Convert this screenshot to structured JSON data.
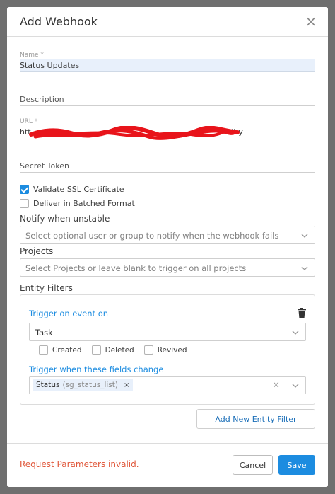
{
  "dialog": {
    "title": "Add Webhook",
    "close_icon": "close-icon"
  },
  "form": {
    "name": {
      "label": "Name *",
      "value": "Status Updates"
    },
    "description": {
      "label": "Description"
    },
    "url": {
      "label": "URL *",
      "value_start": "htt",
      "value_end": "tlby",
      "redacted": true
    },
    "secret_token": {
      "label": "Secret Token"
    },
    "validate_ssl": {
      "label": "Validate SSL Certificate",
      "checked": true
    },
    "batched": {
      "label": "Deliver in Batched Format",
      "checked": false
    },
    "notify": {
      "label": "Notify when unstable",
      "placeholder": "Select optional user or group to notify when the webhook fails"
    },
    "projects": {
      "label": "Projects",
      "placeholder": "Select Projects or leave blank to trigger on all projects"
    }
  },
  "entity_filters": {
    "label": "Entity Filters",
    "trigger_event_label": "Trigger on event on",
    "entity_value": "Task",
    "events": [
      {
        "label": "Created",
        "checked": false
      },
      {
        "label": "Deleted",
        "checked": false
      },
      {
        "label": "Revived",
        "checked": false
      }
    ],
    "fields_label": "Trigger when these fields change",
    "field_tag": {
      "name": "Status",
      "code": "(sg_status_list)",
      "remove": "×"
    },
    "clear": "×"
  },
  "add_filter_label": "Add New Entity Filter",
  "footer": {
    "error": "Request Parameters invalid.",
    "cancel_label": "Cancel",
    "save_label": "Save"
  },
  "colors": {
    "accent": "#1c8ce0",
    "error": "#e0573a",
    "redaction": "#e8141b"
  }
}
